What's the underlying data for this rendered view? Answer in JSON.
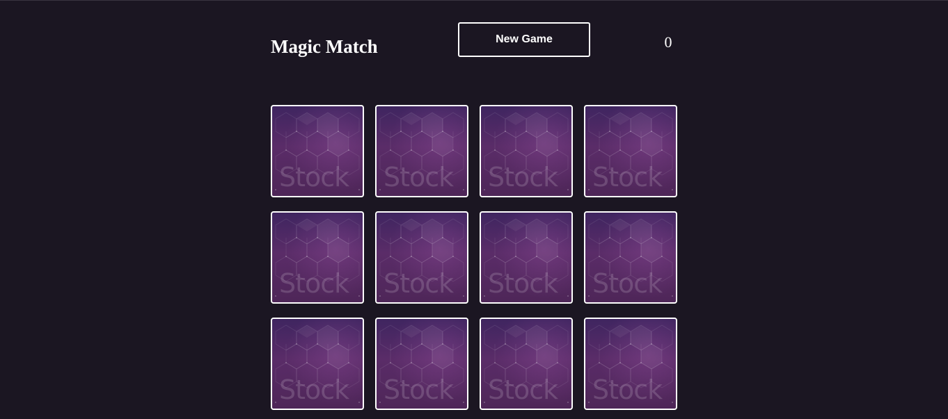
{
  "header": {
    "title": "Magic Match",
    "new_game_label": "New Game",
    "score": "0"
  },
  "colors": {
    "background": "#1b1622",
    "card_border": "#ffffff",
    "card_face": "#542a63"
  },
  "board": {
    "rows": 3,
    "columns": 4,
    "cards": [
      {
        "watermark": "Stock",
        "face_down": true
      },
      {
        "watermark": "Stock",
        "face_down": true
      },
      {
        "watermark": "Stock",
        "face_down": true
      },
      {
        "watermark": "Stock",
        "face_down": true
      },
      {
        "watermark": "Stock",
        "face_down": true
      },
      {
        "watermark": "Stock",
        "face_down": true
      },
      {
        "watermark": "Stock",
        "face_down": true
      },
      {
        "watermark": "Stock",
        "face_down": true
      },
      {
        "watermark": "Stock",
        "face_down": true
      },
      {
        "watermark": "Stock",
        "face_down": true
      },
      {
        "watermark": "Stock",
        "face_down": true
      },
      {
        "watermark": "Stock",
        "face_down": true
      }
    ]
  }
}
